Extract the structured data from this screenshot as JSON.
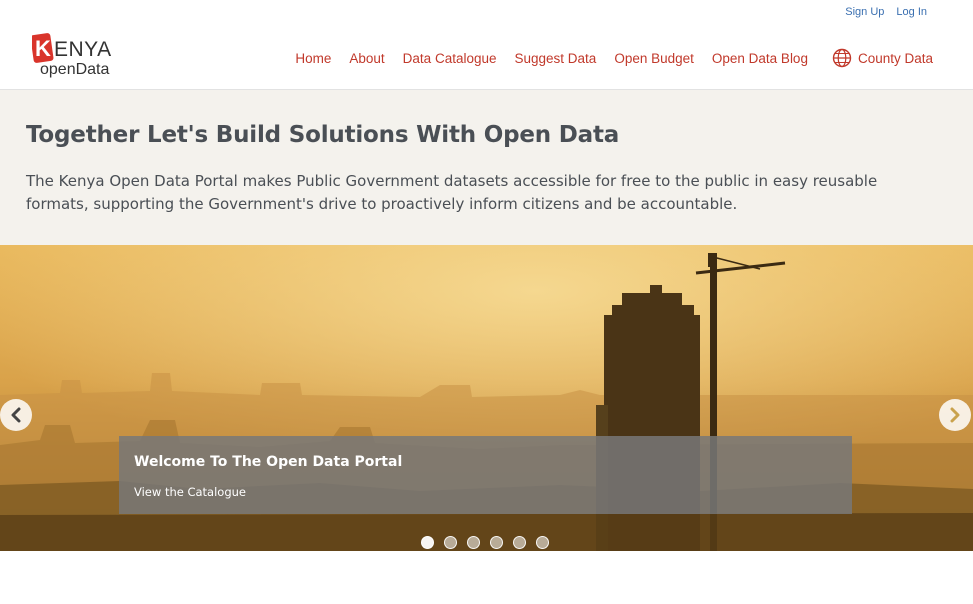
{
  "topbar": {
    "signup": "Sign Up",
    "login": "Log In"
  },
  "logo": {
    "line1": "ENYA",
    "letter": "K",
    "line2": "openData"
  },
  "nav": {
    "items": [
      "Home",
      "About",
      "Data Catalogue",
      "Suggest Data",
      "Open Budget",
      "Open Data Blog"
    ],
    "county": "County Data"
  },
  "hero": {
    "title": "Together Let's Build Solutions With Open Data",
    "description": "The Kenya Open Data Portal makes Public Government datasets accessible for free to the public in easy reusable formats, supporting the Government's drive to proactively inform citizens and be accountable."
  },
  "carousel": {
    "caption_title": "Welcome To The Open Data Portal",
    "caption_link": "View the Catalogue",
    "slide_count": 6,
    "active_slide": 1
  },
  "colors": {
    "brand_red": "#c1392b",
    "link_blue": "#3a6fb0",
    "hero_bg": "#f4f2ed"
  },
  "icons": {
    "prev": "chevron-left-icon",
    "next": "chevron-right-icon",
    "county": "globe-icon"
  }
}
